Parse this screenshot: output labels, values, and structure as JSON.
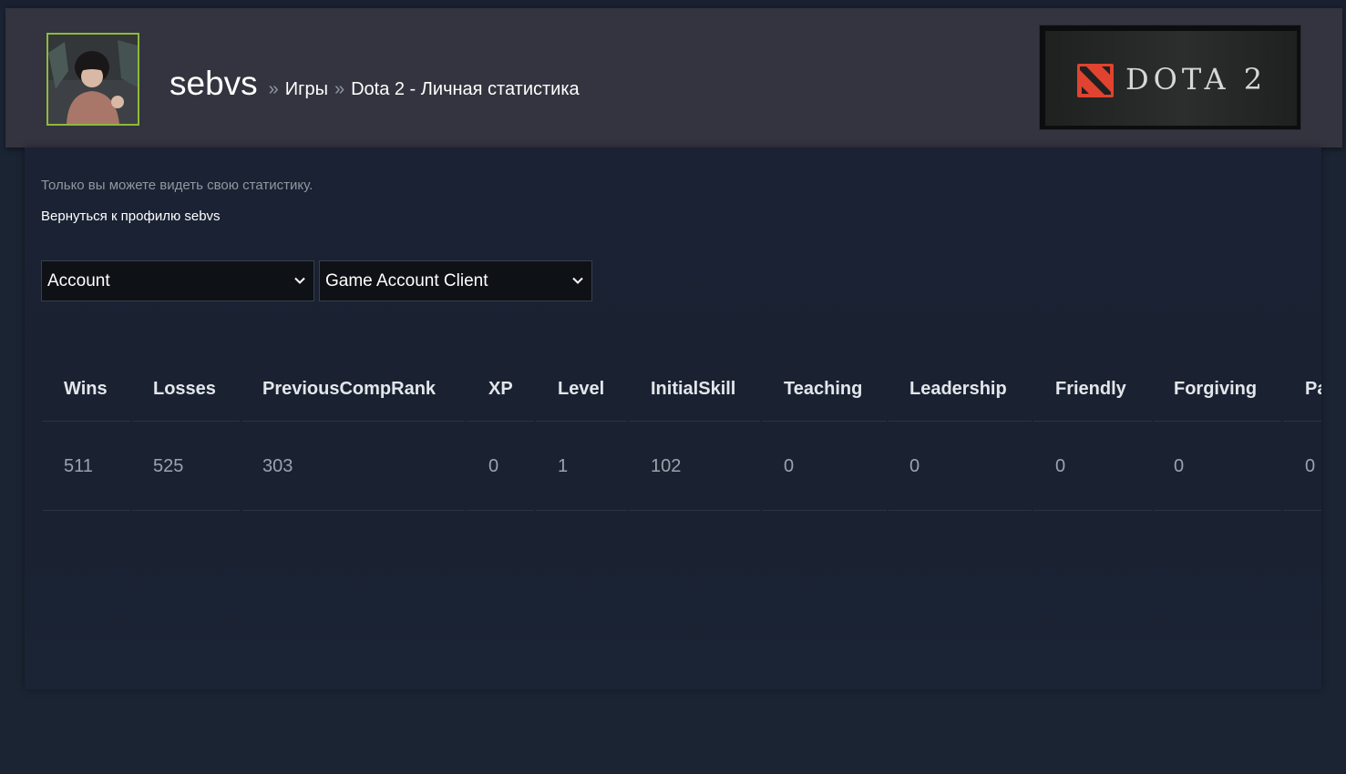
{
  "header": {
    "username": "sebvs",
    "breadcrumb_sep": "»",
    "games_link": "Игры",
    "page_title": "Dota 2 - Личная статистика",
    "game_logo_text": "DOTA 2"
  },
  "info": {
    "privacy_note": "Только вы можете видеть свою статистику.",
    "back_link": "Вернуться к профилю sebvs"
  },
  "filters": {
    "category_selected": "Account",
    "source_selected": "Game Account Client"
  },
  "stats": {
    "columns": [
      "Wins",
      "Losses",
      "PreviousCompRank",
      "XP",
      "Level",
      "InitialSkill",
      "Teaching",
      "Leadership",
      "Friendly",
      "Forgiving",
      "Partn"
    ],
    "values": [
      "511",
      "525",
      "303",
      "0",
      "1",
      "102",
      "0",
      "0",
      "0",
      "0",
      "0"
    ]
  },
  "colors": {
    "header_bg": "#33343f",
    "page_bg": "#1b2433",
    "avatar_border": "#8fb93b",
    "dota_red": "#e0432f"
  },
  "icons": [
    "avatar",
    "dota-logo-icon",
    "chevron-down-icon"
  ]
}
